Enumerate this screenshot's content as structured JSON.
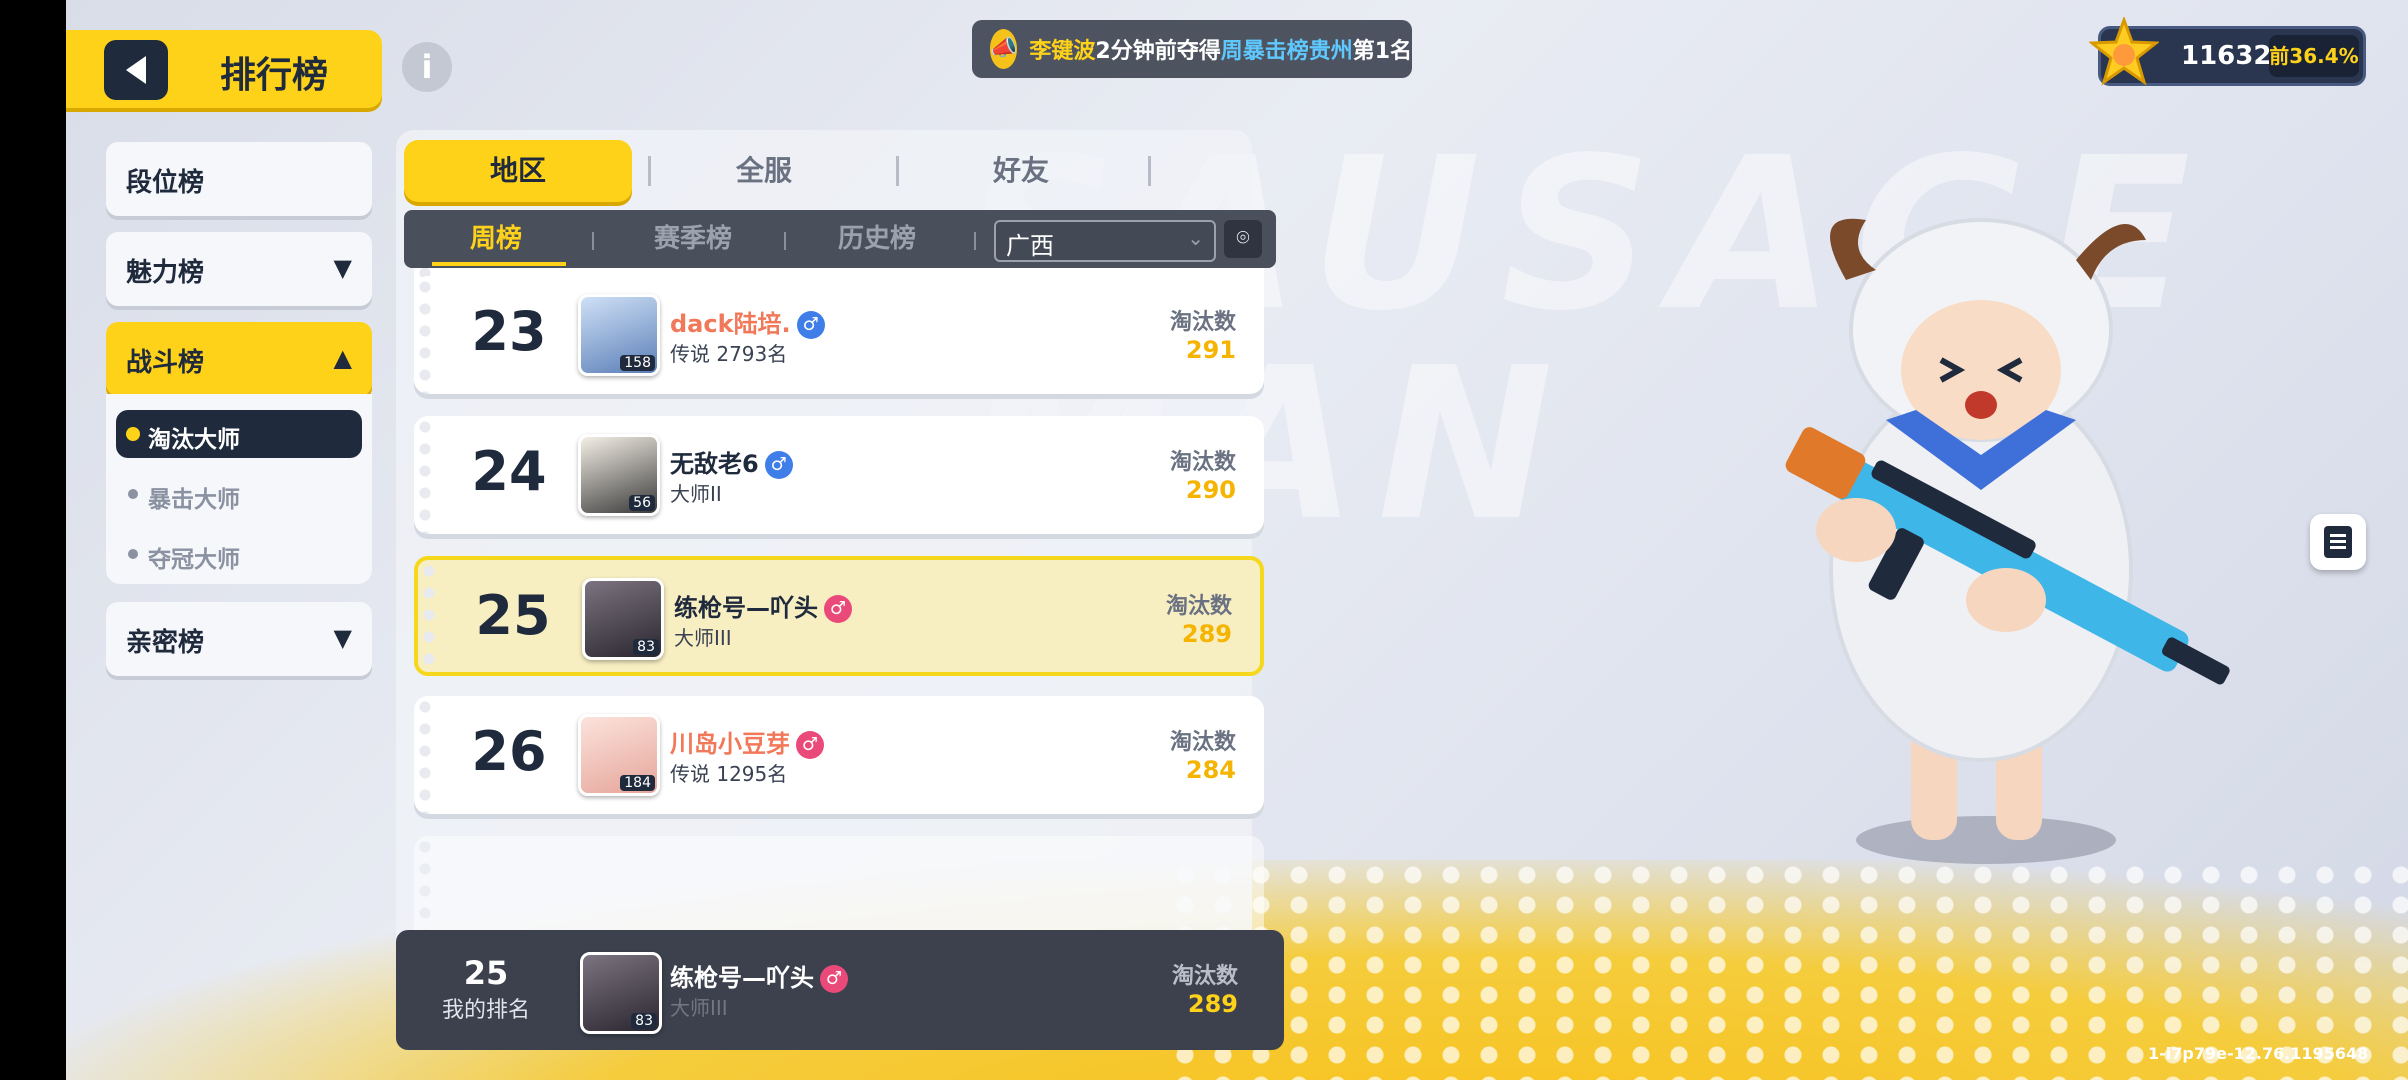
{
  "header": {
    "title": "排行榜",
    "info_icon": "info-icon"
  },
  "announcement": {
    "player": "李键波",
    "text1": "2分钟前夺得",
    "board": "周暴击榜贵州",
    "text2": "第1名"
  },
  "score": {
    "value": "11632",
    "rank": "前36.4%"
  },
  "menu": {
    "duanwei": "段位榜",
    "meili": "魅力榜",
    "zhandou": "战斗榜",
    "qinmi": "亲密榜",
    "sub": [
      "淘汰大师",
      "暴击大师",
      "夺冠大师"
    ]
  },
  "tabs": [
    "地区",
    "全服",
    "好友"
  ],
  "subtabs": [
    "周榜",
    "赛季榜",
    "历史榜"
  ],
  "region": "广西",
  "stat_label": "淘汰数",
  "rows": [
    {
      "rank": "23",
      "name": "dack陆培.",
      "sub": "传说 2793名",
      "level": "158",
      "value": "291"
    },
    {
      "rank": "24",
      "name": "无敌老6",
      "sub": "大师II",
      "level": "56",
      "value": "290"
    },
    {
      "rank": "25",
      "name": "练枪号—吖头",
      "sub": "大师III",
      "level": "83",
      "value": "289"
    },
    {
      "rank": "26",
      "name": "川岛小豆芽",
      "sub": "传说 1295名",
      "level": "184",
      "value": "284"
    }
  ],
  "my": {
    "rank": "25",
    "label": "我的排名",
    "name": "练枪号—吖头",
    "sub": "大师III",
    "level": "83",
    "value": "289"
  },
  "watermark": "SAUSAGE MAN",
  "version": "1-i7p79e-12.76.1195648",
  "colors": {
    "accent": "#ffd21a",
    "dark": "#1f2a3c",
    "value": "#f5b400"
  }
}
